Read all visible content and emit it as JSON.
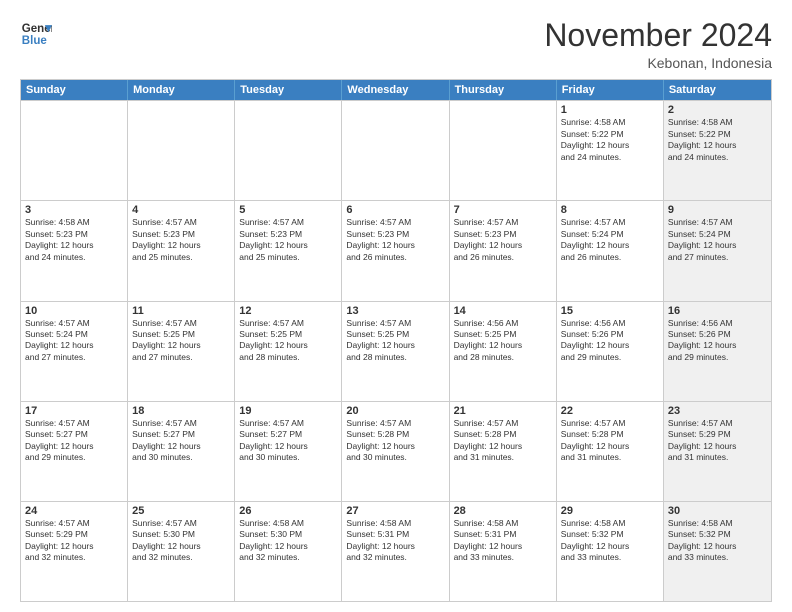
{
  "header": {
    "logo_line1": "General",
    "logo_line2": "Blue",
    "month_title": "November 2024",
    "location": "Kebonan, Indonesia"
  },
  "weekdays": [
    "Sunday",
    "Monday",
    "Tuesday",
    "Wednesday",
    "Thursday",
    "Friday",
    "Saturday"
  ],
  "weeks": [
    [
      {
        "day": "",
        "info": "",
        "shaded": false
      },
      {
        "day": "",
        "info": "",
        "shaded": false
      },
      {
        "day": "",
        "info": "",
        "shaded": false
      },
      {
        "day": "",
        "info": "",
        "shaded": false
      },
      {
        "day": "",
        "info": "",
        "shaded": false
      },
      {
        "day": "1",
        "info": "Sunrise: 4:58 AM\nSunset: 5:22 PM\nDaylight: 12 hours\nand 24 minutes.",
        "shaded": false
      },
      {
        "day": "2",
        "info": "Sunrise: 4:58 AM\nSunset: 5:22 PM\nDaylight: 12 hours\nand 24 minutes.",
        "shaded": true
      }
    ],
    [
      {
        "day": "3",
        "info": "Sunrise: 4:58 AM\nSunset: 5:23 PM\nDaylight: 12 hours\nand 24 minutes.",
        "shaded": false
      },
      {
        "day": "4",
        "info": "Sunrise: 4:57 AM\nSunset: 5:23 PM\nDaylight: 12 hours\nand 25 minutes.",
        "shaded": false
      },
      {
        "day": "5",
        "info": "Sunrise: 4:57 AM\nSunset: 5:23 PM\nDaylight: 12 hours\nand 25 minutes.",
        "shaded": false
      },
      {
        "day": "6",
        "info": "Sunrise: 4:57 AM\nSunset: 5:23 PM\nDaylight: 12 hours\nand 26 minutes.",
        "shaded": false
      },
      {
        "day": "7",
        "info": "Sunrise: 4:57 AM\nSunset: 5:23 PM\nDaylight: 12 hours\nand 26 minutes.",
        "shaded": false
      },
      {
        "day": "8",
        "info": "Sunrise: 4:57 AM\nSunset: 5:24 PM\nDaylight: 12 hours\nand 26 minutes.",
        "shaded": false
      },
      {
        "day": "9",
        "info": "Sunrise: 4:57 AM\nSunset: 5:24 PM\nDaylight: 12 hours\nand 27 minutes.",
        "shaded": true
      }
    ],
    [
      {
        "day": "10",
        "info": "Sunrise: 4:57 AM\nSunset: 5:24 PM\nDaylight: 12 hours\nand 27 minutes.",
        "shaded": false
      },
      {
        "day": "11",
        "info": "Sunrise: 4:57 AM\nSunset: 5:25 PM\nDaylight: 12 hours\nand 27 minutes.",
        "shaded": false
      },
      {
        "day": "12",
        "info": "Sunrise: 4:57 AM\nSunset: 5:25 PM\nDaylight: 12 hours\nand 28 minutes.",
        "shaded": false
      },
      {
        "day": "13",
        "info": "Sunrise: 4:57 AM\nSunset: 5:25 PM\nDaylight: 12 hours\nand 28 minutes.",
        "shaded": false
      },
      {
        "day": "14",
        "info": "Sunrise: 4:56 AM\nSunset: 5:25 PM\nDaylight: 12 hours\nand 28 minutes.",
        "shaded": false
      },
      {
        "day": "15",
        "info": "Sunrise: 4:56 AM\nSunset: 5:26 PM\nDaylight: 12 hours\nand 29 minutes.",
        "shaded": false
      },
      {
        "day": "16",
        "info": "Sunrise: 4:56 AM\nSunset: 5:26 PM\nDaylight: 12 hours\nand 29 minutes.",
        "shaded": true
      }
    ],
    [
      {
        "day": "17",
        "info": "Sunrise: 4:57 AM\nSunset: 5:27 PM\nDaylight: 12 hours\nand 29 minutes.",
        "shaded": false
      },
      {
        "day": "18",
        "info": "Sunrise: 4:57 AM\nSunset: 5:27 PM\nDaylight: 12 hours\nand 30 minutes.",
        "shaded": false
      },
      {
        "day": "19",
        "info": "Sunrise: 4:57 AM\nSunset: 5:27 PM\nDaylight: 12 hours\nand 30 minutes.",
        "shaded": false
      },
      {
        "day": "20",
        "info": "Sunrise: 4:57 AM\nSunset: 5:28 PM\nDaylight: 12 hours\nand 30 minutes.",
        "shaded": false
      },
      {
        "day": "21",
        "info": "Sunrise: 4:57 AM\nSunset: 5:28 PM\nDaylight: 12 hours\nand 31 minutes.",
        "shaded": false
      },
      {
        "day": "22",
        "info": "Sunrise: 4:57 AM\nSunset: 5:28 PM\nDaylight: 12 hours\nand 31 minutes.",
        "shaded": false
      },
      {
        "day": "23",
        "info": "Sunrise: 4:57 AM\nSunset: 5:29 PM\nDaylight: 12 hours\nand 31 minutes.",
        "shaded": true
      }
    ],
    [
      {
        "day": "24",
        "info": "Sunrise: 4:57 AM\nSunset: 5:29 PM\nDaylight: 12 hours\nand 32 minutes.",
        "shaded": false
      },
      {
        "day": "25",
        "info": "Sunrise: 4:57 AM\nSunset: 5:30 PM\nDaylight: 12 hours\nand 32 minutes.",
        "shaded": false
      },
      {
        "day": "26",
        "info": "Sunrise: 4:58 AM\nSunset: 5:30 PM\nDaylight: 12 hours\nand 32 minutes.",
        "shaded": false
      },
      {
        "day": "27",
        "info": "Sunrise: 4:58 AM\nSunset: 5:31 PM\nDaylight: 12 hours\nand 32 minutes.",
        "shaded": false
      },
      {
        "day": "28",
        "info": "Sunrise: 4:58 AM\nSunset: 5:31 PM\nDaylight: 12 hours\nand 33 minutes.",
        "shaded": false
      },
      {
        "day": "29",
        "info": "Sunrise: 4:58 AM\nSunset: 5:32 PM\nDaylight: 12 hours\nand 33 minutes.",
        "shaded": false
      },
      {
        "day": "30",
        "info": "Sunrise: 4:58 AM\nSunset: 5:32 PM\nDaylight: 12 hours\nand 33 minutes.",
        "shaded": true
      }
    ]
  ]
}
